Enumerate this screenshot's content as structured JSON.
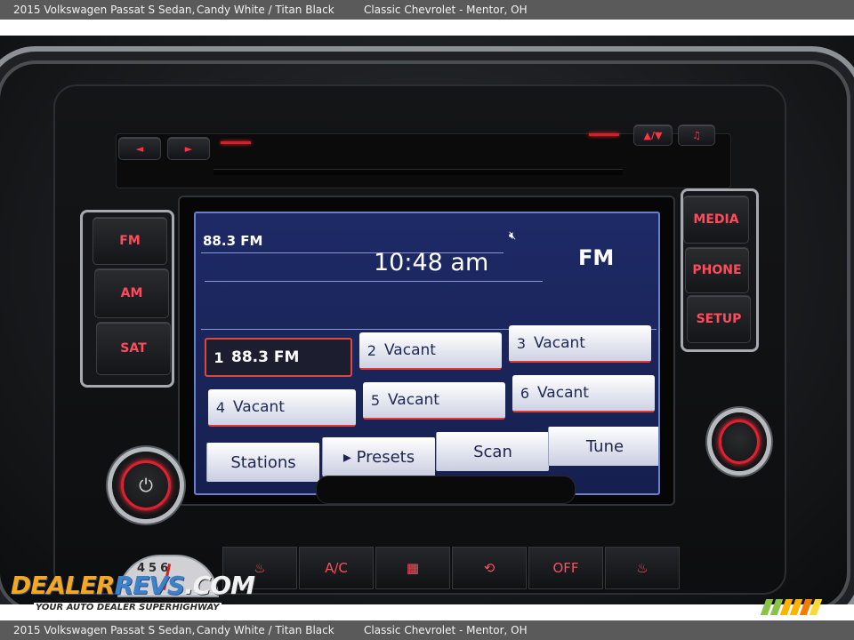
{
  "caption": {
    "vehicle": "2015 Volkswagen Passat S Sedan,",
    "colors": "Candy White / Titan Black",
    "dealer": "Classic Chevrolet - Mentor, OH"
  },
  "radio": {
    "top_buttons": {
      "left_arrow": "◄",
      "right_arrow": "►",
      "eject": "▲/▼",
      "music": "♫"
    },
    "left_buttons": [
      "FM",
      "AM",
      "SAT"
    ],
    "right_buttons": [
      "MEDIA",
      "PHONE",
      "SETUP"
    ],
    "screen": {
      "station_freq": "88.3 FM",
      "mute_icon": "speaker-mute-icon",
      "clock": "10:48 am",
      "band": "FM",
      "presets": [
        {
          "number": "1",
          "label": "88.3 FM"
        },
        {
          "number": "2",
          "label": "Vacant"
        },
        {
          "number": "3",
          "label": "Vacant"
        },
        {
          "number": "4",
          "label": "Vacant"
        },
        {
          "number": "5",
          "label": "Vacant"
        },
        {
          "number": "6",
          "label": "Vacant"
        }
      ],
      "active_preset": 1,
      "softkeys": [
        "Stations",
        "▸ Presets",
        "Scan",
        "Tune"
      ]
    },
    "climate_buttons": [
      "A/C",
      "OFF"
    ]
  },
  "watermark": {
    "brand_part1": "DEALER",
    "brand_part2": "REVS",
    "brand_part3": ".COM",
    "tagline": "YOUR AUTO DEALER SUPERHIGHWAY",
    "gauge_digits": "456"
  },
  "colors": {
    "accent_red": "#ff3344",
    "screen_blue": "#1e2a66",
    "caption_gray": "#5a5a5a"
  }
}
